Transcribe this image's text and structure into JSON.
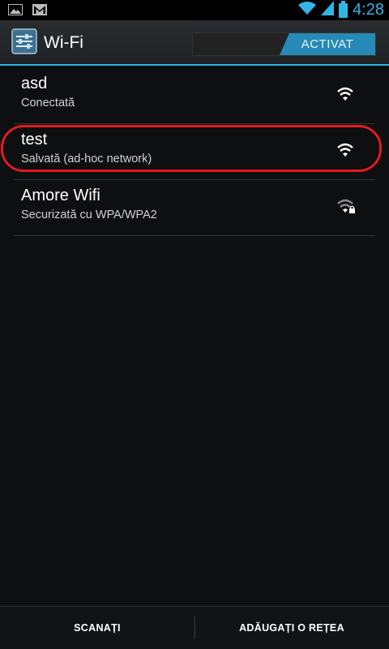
{
  "status_bar": {
    "time": "4:28",
    "icons": [
      "gallery-icon",
      "gmail-icon",
      "wifi-icon",
      "signal-icon",
      "battery-icon"
    ],
    "accent_color": "#33b5e5"
  },
  "action_bar": {
    "title": "Wi-Fi",
    "toggle_label": "ACTIVAT",
    "toggle_color": "#2789b6"
  },
  "networks": [
    {
      "name": "asd",
      "status": "Conectată",
      "icon": "wifi-full-icon",
      "secured": false
    },
    {
      "name": "test",
      "status": "Salvată (ad-hoc network)",
      "icon": "wifi-full-icon",
      "secured": false,
      "annotated": true
    },
    {
      "name": "Amore Wifi",
      "status": "Securizată cu WPA/WPA2",
      "icon": "wifi-locked-icon",
      "secured": true
    }
  ],
  "bottom_bar": {
    "scan_label": "SCANAȚI",
    "add_label": "ADĂUGAȚI O REȚEA"
  },
  "annotation_color": "#e11a1e"
}
